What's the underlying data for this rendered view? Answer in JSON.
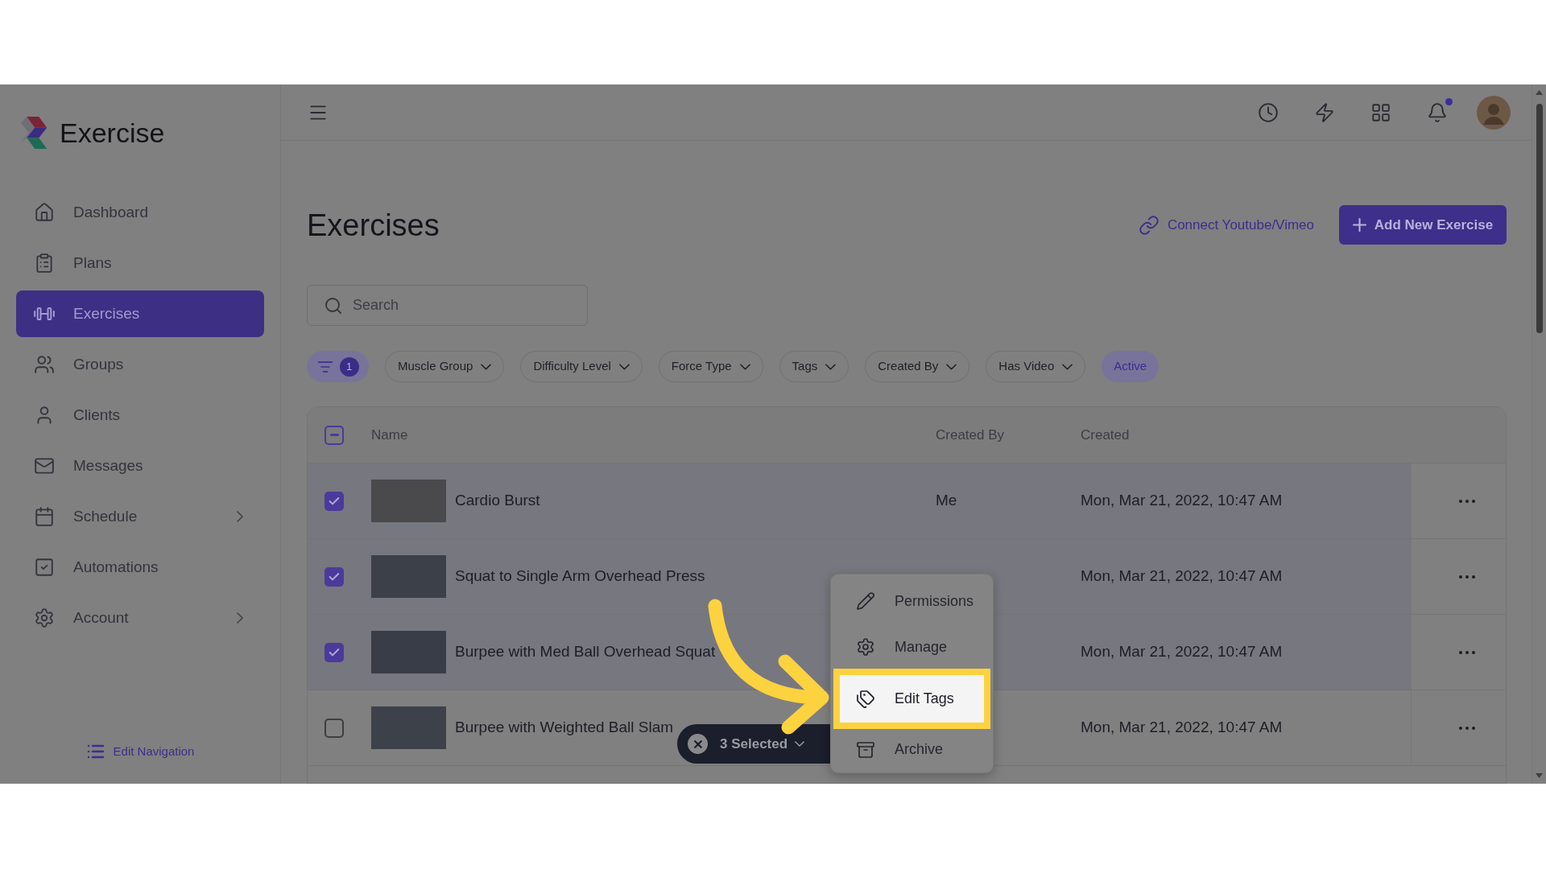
{
  "app": {
    "name": "Exercise"
  },
  "sidebar": {
    "items": [
      {
        "label": "Dashboard",
        "selected": false,
        "submenu": false
      },
      {
        "label": "Plans",
        "selected": false,
        "submenu": false
      },
      {
        "label": "Exercises",
        "selected": true,
        "submenu": false
      },
      {
        "label": "Groups",
        "selected": false,
        "submenu": false
      },
      {
        "label": "Clients",
        "selected": false,
        "submenu": false
      },
      {
        "label": "Messages",
        "selected": false,
        "submenu": false
      },
      {
        "label": "Schedule",
        "selected": false,
        "submenu": true
      },
      {
        "label": "Automations",
        "selected": false,
        "submenu": false
      },
      {
        "label": "Account",
        "selected": false,
        "submenu": true
      }
    ],
    "edit_navigation": "Edit Navigation"
  },
  "header": {
    "notifications_unread": true
  },
  "page": {
    "title": "Exercises",
    "connect_link": "Connect Youtube/Vimeo",
    "add_button": "Add New Exercise"
  },
  "search": {
    "placeholder": "Search"
  },
  "filters": [
    {
      "kind": "filter",
      "count": "1"
    },
    {
      "kind": "dropdown",
      "label": "Muscle Group"
    },
    {
      "kind": "dropdown",
      "label": "Difficulty Level"
    },
    {
      "kind": "dropdown",
      "label": "Force Type"
    },
    {
      "kind": "dropdown",
      "label": "Tags"
    },
    {
      "kind": "dropdown",
      "label": "Created By"
    },
    {
      "kind": "dropdown",
      "label": "Has Video"
    },
    {
      "kind": "toggle",
      "label": "Active",
      "on": true
    }
  ],
  "table": {
    "select_all": {
      "indeterminate": true
    },
    "columns": [
      {
        "label": "Name"
      },
      {
        "label": "Created By"
      },
      {
        "label": "Created"
      }
    ],
    "rows": [
      {
        "name": "Cardio Burst",
        "created_by": "Me",
        "created": "Mon, Mar 21, 2022, 10:47 AM",
        "selected": true
      },
      {
        "name": "Squat to Single Arm Overhead Press",
        "created": "Mon, Mar 21, 2022, 10:47 AM",
        "selected": true
      },
      {
        "name": "Burpee with Med Ball Overhead Squat",
        "created": "Mon, Mar 21, 2022, 10:47 AM",
        "selected": true
      },
      {
        "name": "Burpee with Weighted Ball Slam",
        "created": "Mon, Mar 21, 2022, 10:47 AM",
        "selected": false
      }
    ]
  },
  "selection": {
    "label": "3 Selected"
  },
  "context_menu": {
    "items": [
      {
        "label": "Permissions",
        "highlighted": false
      },
      {
        "label": "Manage",
        "highlighted": false
      },
      {
        "label": "Edit Tags",
        "highlighted": true
      },
      {
        "label": "Archive",
        "highlighted": false
      }
    ]
  }
}
